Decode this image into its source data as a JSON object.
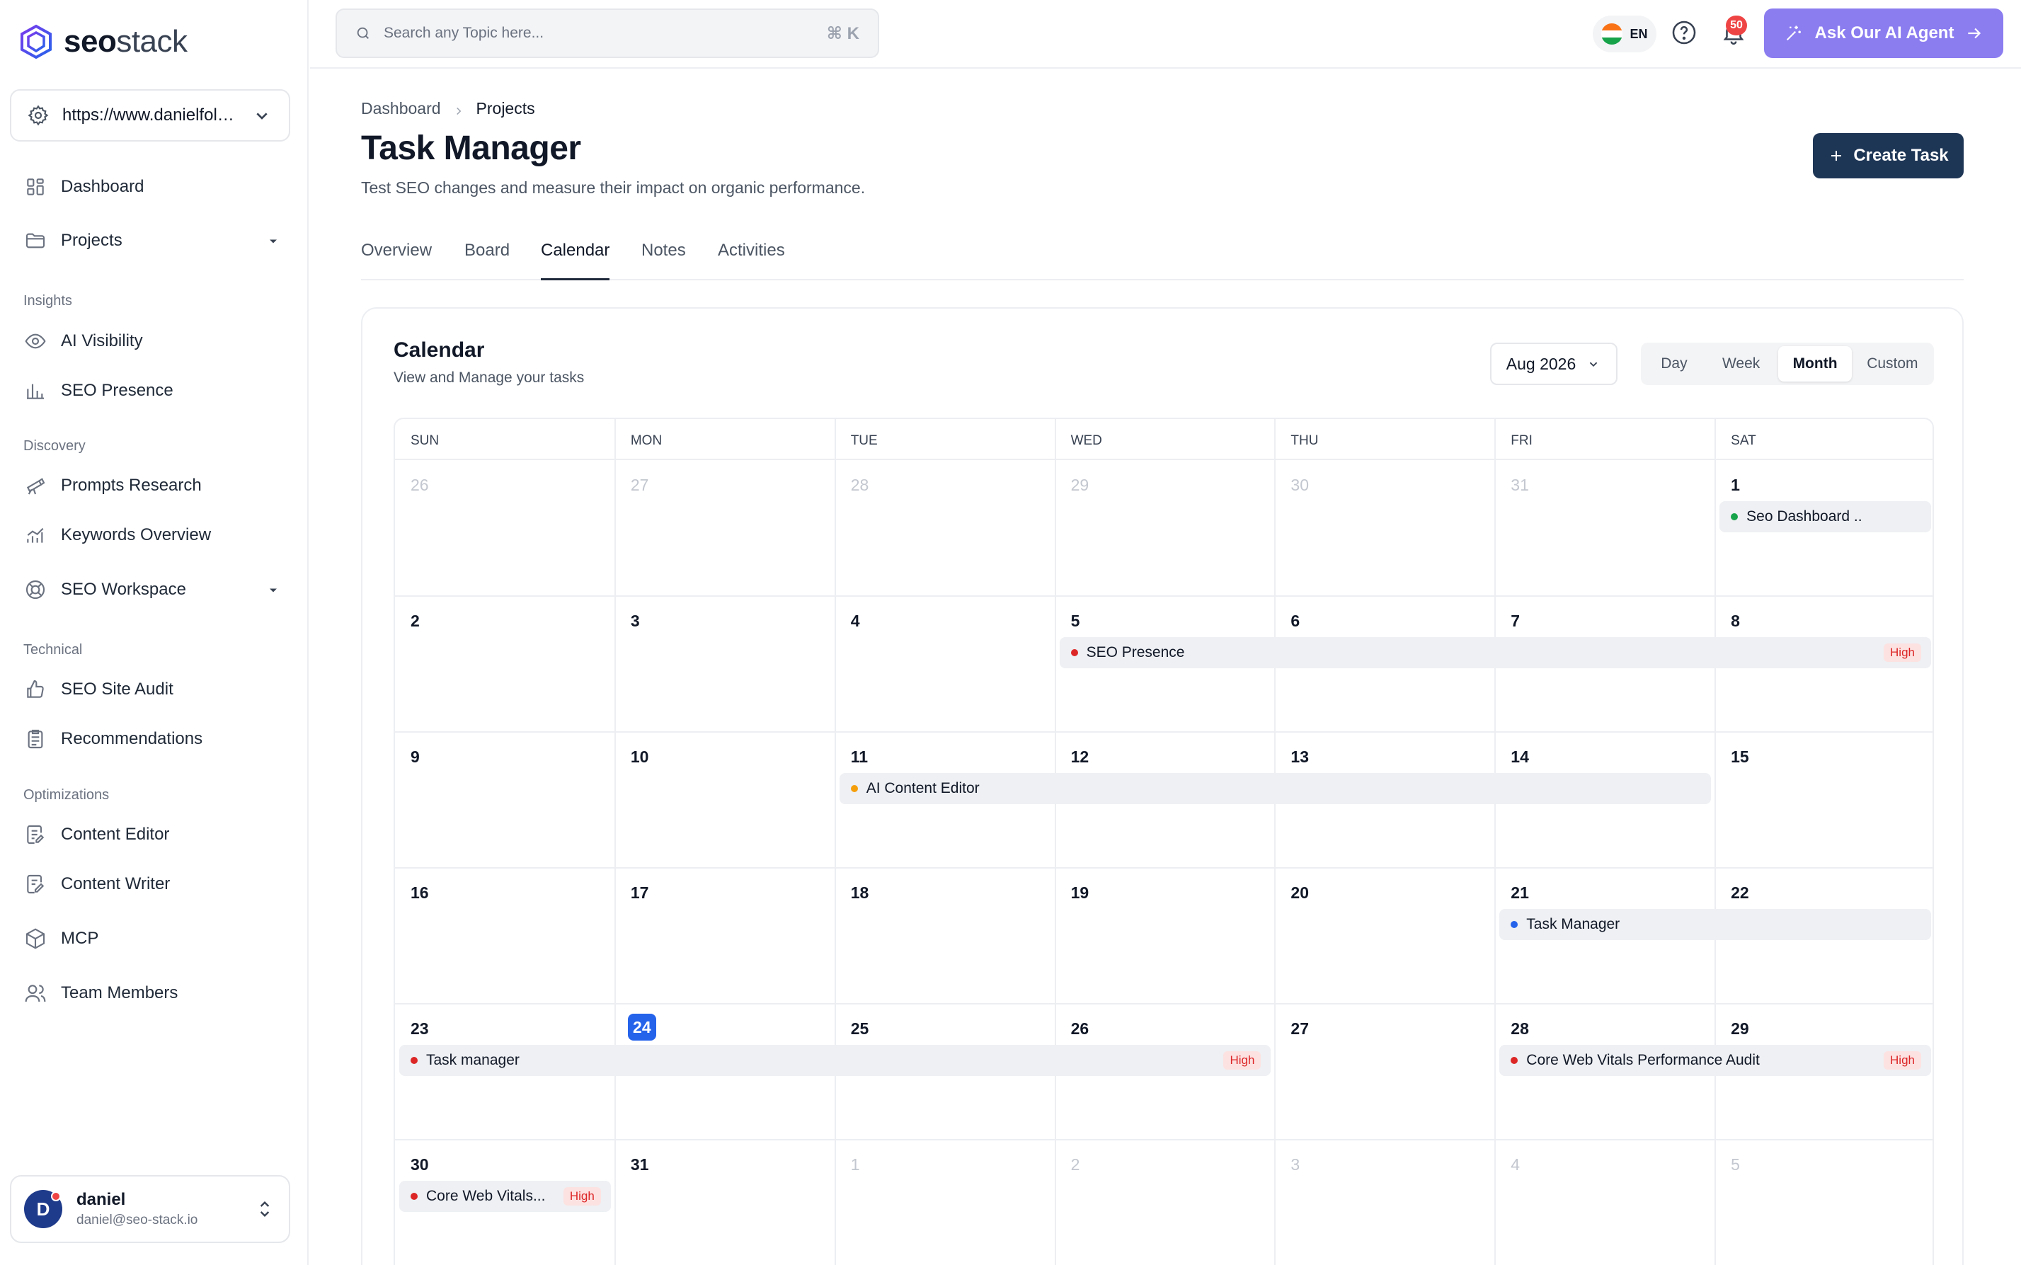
{
  "app": {
    "logo_strong": "seo",
    "logo_rest": "stack"
  },
  "site_selector": {
    "url": "https://www.danielfole..."
  },
  "sidebar": {
    "items": [
      {
        "label": "Dashboard"
      },
      {
        "label": "Projects"
      },
      {
        "label": "AI Visibility"
      },
      {
        "label": "SEO Presence"
      },
      {
        "label": "Prompts Research"
      },
      {
        "label": "Keywords Overview"
      },
      {
        "label": "SEO Workspace"
      },
      {
        "label": "SEO Site Audit"
      },
      {
        "label": "Recommendations"
      },
      {
        "label": "Content Editor"
      },
      {
        "label": "Content Writer"
      },
      {
        "label": "MCP"
      },
      {
        "label": "Team Members"
      }
    ],
    "sections": [
      "Insights",
      "Discovery",
      "Technical",
      "Optimizations"
    ]
  },
  "user": {
    "initial": "D",
    "name": "daniel",
    "email": "daniel@seo-stack.io"
  },
  "topbar": {
    "search_placeholder": "Search any Topic here...",
    "shortcut": "⌘ K",
    "language": "EN",
    "notification_count": "50",
    "ai_button": "Ask Our AI Agent"
  },
  "breadcrumb": [
    "Dashboard",
    "Projects"
  ],
  "page": {
    "title": "Task Manager",
    "subtitle": "Test SEO changes and measure their impact on organic performance.",
    "create_button": "Create Task"
  },
  "tabs": [
    "Overview",
    "Board",
    "Calendar",
    "Notes",
    "Activities"
  ],
  "active_tab": "Calendar",
  "calendar": {
    "title": "Calendar",
    "subtitle": "View and Manage your tasks",
    "month": "Aug 2026",
    "views": [
      "Day",
      "Week",
      "Month",
      "Custom"
    ],
    "active_view": "Month",
    "weekdays": [
      "SUN",
      "MON",
      "TUE",
      "WED",
      "THU",
      "FRI",
      "SAT"
    ],
    "weeks": [
      [
        "26",
        "27",
        "28",
        "29",
        "30",
        "31",
        "1"
      ],
      [
        "2",
        "3",
        "4",
        "5",
        "6",
        "7",
        "8"
      ],
      [
        "9",
        "10",
        "11",
        "12",
        "13",
        "14",
        "15"
      ],
      [
        "16",
        "17",
        "18",
        "19",
        "20",
        "21",
        "22"
      ],
      [
        "23",
        "24",
        "25",
        "26",
        "27",
        "28",
        "29"
      ],
      [
        "30",
        "31",
        "1",
        "2",
        "3",
        "4",
        "5"
      ]
    ],
    "today": "24",
    "events": [
      {
        "title": "Seo Dashboard ..",
        "priority": "",
        "color": "#16a34a"
      },
      {
        "title": "SEO Presence",
        "priority": "High",
        "color": "#dc2626"
      },
      {
        "title": "AI Content Editor",
        "priority": "",
        "color": "#f59e0b"
      },
      {
        "title": "Task Manager",
        "priority": "",
        "color": "#2563eb"
      },
      {
        "title": "Task manager",
        "priority": "High",
        "color": "#dc2626"
      },
      {
        "title": "Core Web Vitals Performance Audit",
        "priority": "High",
        "color": "#dc2626"
      },
      {
        "title": "Core Web Vitals...",
        "priority": "High",
        "color": "#dc2626"
      }
    ]
  }
}
